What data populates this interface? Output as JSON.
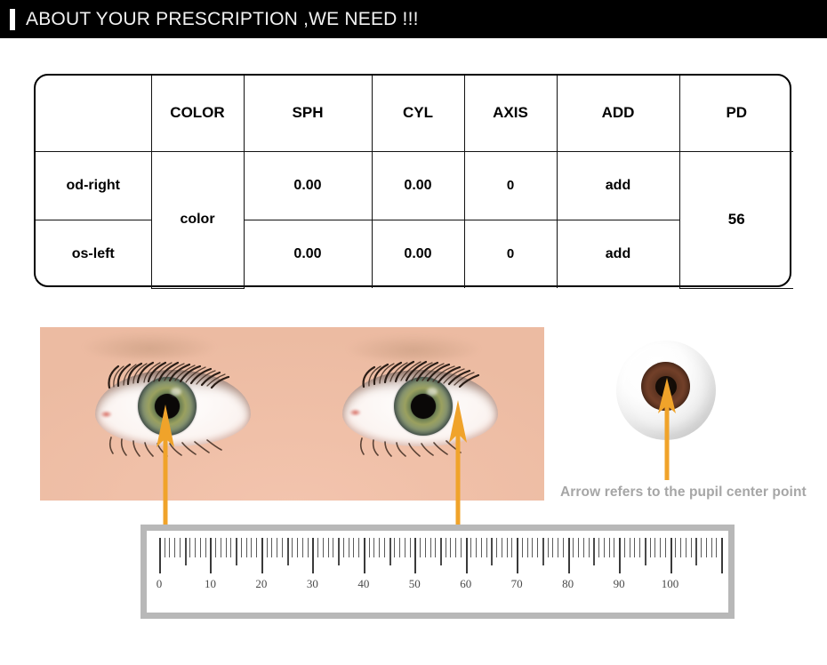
{
  "header": {
    "title": "ABOUT YOUR PRESCRIPTION ,WE NEED !!!",
    "accent_color": "#ffffff",
    "background_color": "#000000"
  },
  "prescription_table": {
    "columns": [
      "",
      "COLOR",
      "SPH",
      "CYL",
      "AXIS",
      "ADD",
      "PD"
    ],
    "rows": [
      {
        "label": "od-right",
        "color": "color",
        "sph": "0.00",
        "cyl": "0.00",
        "axis": "0",
        "add": "add",
        "pd": "56"
      },
      {
        "label": "os-left",
        "color": "color",
        "sph": "0.00",
        "cyl": "0.00",
        "axis": "0",
        "add": "add",
        "pd": "56"
      }
    ]
  },
  "diagram": {
    "pupil_caption": "Arrow refers to the pupil center point",
    "caption_color": "#a6a6a6",
    "arrow_color": "#f0a32a"
  },
  "ruler": {
    "labels": [
      "0",
      "10",
      "20",
      "30",
      "40",
      "50",
      "60",
      "70",
      "80",
      "90",
      "100"
    ],
    "min": 0,
    "max": 110,
    "border_color": "#b8b8b8",
    "face_color": "#ffffff"
  }
}
